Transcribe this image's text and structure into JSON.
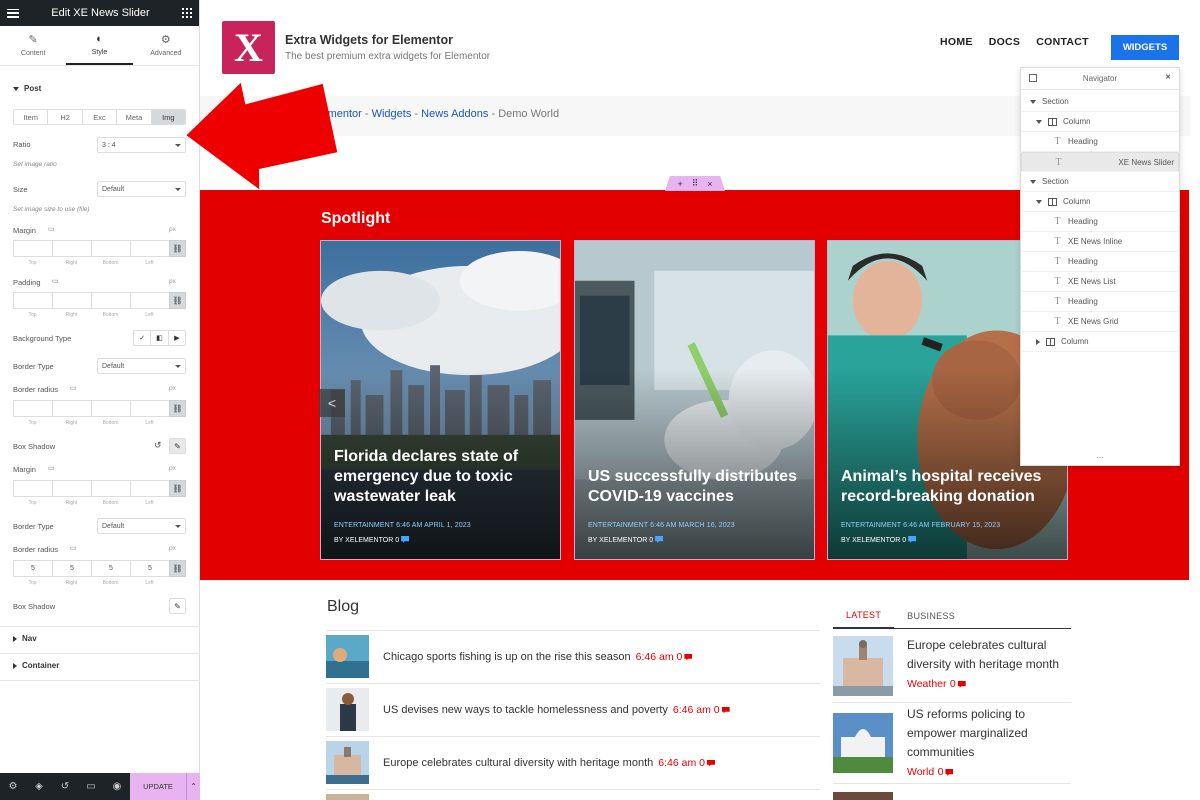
{
  "panel": {
    "title": "Edit XE News Slider",
    "tabs": [
      {
        "label": "Content",
        "icon": "pencil-icon"
      },
      {
        "label": "Style",
        "icon": "contrast-icon"
      },
      {
        "label": "Advanced",
        "icon": "gear-icon"
      }
    ],
    "post_section": "Post",
    "subtabs": [
      "Item",
      "H2",
      "Exc",
      "Meta",
      "Img"
    ],
    "ratio_label": "Ratio",
    "ratio_value": "3 : 4",
    "ratio_hint": "Set image ratio",
    "size_label": "Size",
    "size_value": "Default",
    "size_hint": "Set image size to use (file)",
    "margin_label": "Margin",
    "padding_label": "Padding",
    "unit": "px",
    "dim_labels": [
      "Top",
      "Right",
      "Bottom",
      "Left"
    ],
    "bg_type_label": "Background Type",
    "border_type_label": "Border Type",
    "border_type_value": "Default",
    "border_radius_label": "Border radius",
    "box_shadow_label": "Box Shadow",
    "margin2_label": "Margin",
    "border_type2_label": "Border Type",
    "border_type2_value": "Default",
    "border_radius2_label": "Border radius",
    "border_radius2_values": [
      "5",
      "5",
      "5",
      "5"
    ],
    "box_shadow2_label": "Box Shadow",
    "nav_section": "Nav",
    "container_section": "Container",
    "update_label": "UPDATE"
  },
  "site": {
    "logo_letter": "X",
    "brand": "Extra Widgets for Elementor",
    "tagline": "The best premium extra widgets for Elementor",
    "nav": [
      "HOME",
      "DOCS",
      "CONTACT"
    ],
    "cta": "WIDGETS",
    "breadcrumb": {
      "part1": "Widgets for Elementor",
      "sep1": " - ",
      "part2": "Widgets",
      "sep2": " - ",
      "part3": "News Addons",
      "sep3": " - ",
      "current": "Demo World"
    }
  },
  "spotlight": {
    "title": "Spotlight",
    "prev_label": "<",
    "cards": [
      {
        "title": "Florida declares state of emergency due to toxic wastewater leak",
        "meta": "ENTERTAINMENT  6:46 AM  APRIL 1, 2023",
        "byline": "BY XELEMENTOR  0"
      },
      {
        "title": "US successfully distributes COVID-19 vaccines",
        "meta": "ENTERTAINMENT  6:46 AM  MARCH 16, 2023",
        "byline": "BY XELEMENTOR  0"
      },
      {
        "title": "Animal’s hospital receives record-breaking donation",
        "meta": "ENTERTAINMENT  6:46 AM  FEBRUARY 15, 2023",
        "byline": "BY XELEMENTOR  0"
      }
    ]
  },
  "navigator": {
    "title": "Navigator",
    "items": [
      {
        "label": "Section"
      },
      {
        "label": "Column"
      },
      {
        "label": "Heading"
      },
      {
        "label": "XE News Slider"
      },
      {
        "label": "Section"
      },
      {
        "label": "Column"
      },
      {
        "label": "Heading"
      },
      {
        "label": "XE News Inline"
      },
      {
        "label": "Heading"
      },
      {
        "label": "XE News List"
      },
      {
        "label": "Heading"
      },
      {
        "label": "XE News Grid"
      },
      {
        "label": "Column"
      }
    ]
  },
  "blog": {
    "title": "Blog",
    "posts": [
      {
        "title": "Chicago sports fishing is up on the rise this season",
        "time": "6:46 am",
        "comments": "0"
      },
      {
        "title": "US devises new ways to tackle homelessness and poverty",
        "time": "6:46 am",
        "comments": "0"
      },
      {
        "title": "Europe celebrates cultural diversity with heritage month",
        "time": "6:46 am",
        "comments": "0"
      }
    ],
    "side_tabs": [
      "LATEST",
      "BUSINESS"
    ],
    "side_posts": [
      {
        "title": "Europe celebrates cultural diversity with heritage month",
        "category": "Weather",
        "comments": "0"
      },
      {
        "title": "US reforms policing to empower marginalized communities",
        "category": "World",
        "comments": "0"
      }
    ]
  },
  "colors": {
    "accent_red": "#e30000",
    "brand_pink": "#c8245c",
    "cta_blue": "#1a73e8",
    "editor_dark": "#1d2327",
    "editor_pink": "#e7b4f0"
  }
}
